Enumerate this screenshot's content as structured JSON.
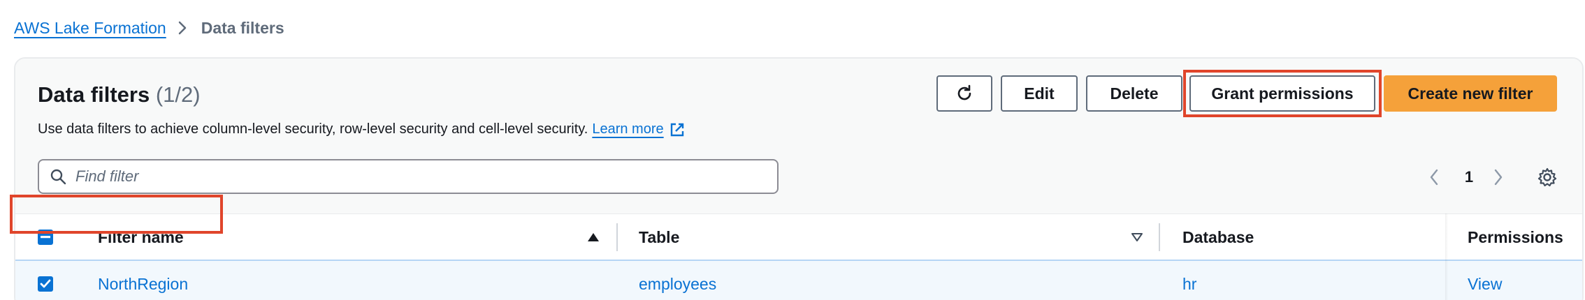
{
  "breadcrumb": {
    "parent": "AWS Lake Formation",
    "current": "Data filters",
    "separator_icon": "chevron-right-icon"
  },
  "header": {
    "title": "Data filters",
    "count": "(1/2)",
    "description": "Use data filters to achieve column-level security, row-level security and cell-level security.",
    "learn_more": "Learn more",
    "learn_more_icon": "external-link-icon"
  },
  "actions": {
    "refresh_icon": "refresh-icon",
    "edit": "Edit",
    "delete": "Delete",
    "grant": "Grant permissions",
    "create": "Create new filter"
  },
  "search": {
    "placeholder": "Find filter",
    "value": ""
  },
  "pagination": {
    "current_page": "1"
  },
  "table": {
    "columns": [
      "Filter name",
      "Table",
      "Database",
      "Permissions"
    ],
    "rows": [
      {
        "selected": true,
        "filter_name": "NorthRegion",
        "table": "employees",
        "database": "hr",
        "permissions": "View"
      }
    ]
  },
  "colors": {
    "link": "#0972d3",
    "primary_button": "#f5a13a",
    "highlight_box": "#e0452b",
    "selected_row": "#f2f8fd"
  }
}
